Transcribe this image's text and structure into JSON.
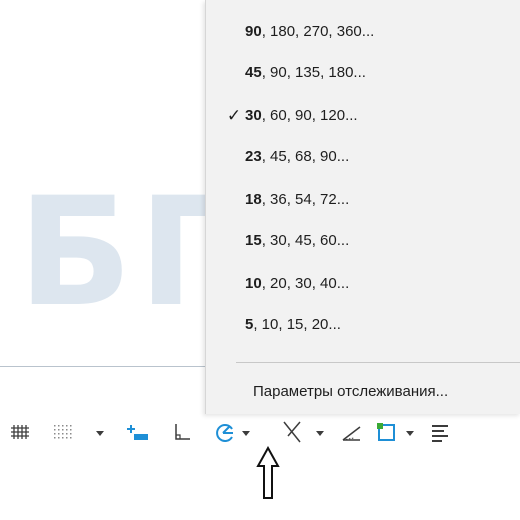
{
  "watermark": {
    "text": "БГАРФ"
  },
  "angle_menu": {
    "selected_index": 2,
    "check_glyph": "✓",
    "items": [
      {
        "bold": "90",
        "rest": ", 180, 270, 360..."
      },
      {
        "bold": "45",
        "rest": ", 90, 135, 180..."
      },
      {
        "bold": "30",
        "rest": ", 60, 90, 120..."
      },
      {
        "bold": "23",
        "rest": ", 45, 68, 90..."
      },
      {
        "bold": "18",
        "rest": ", 36, 54, 72..."
      },
      {
        "bold": "15",
        "rest": ", 30, 45, 60..."
      },
      {
        "bold": "10",
        "rest": ", 20, 30, 40..."
      },
      {
        "bold": "5",
        "rest": ", 10, 15, 20..."
      }
    ],
    "tracking_settings_label": "Параметры отслеживания..."
  },
  "toolbar": {
    "icons": [
      "grid-display-icon",
      "snap-grid-icon",
      "dropdown-arrow-icon",
      "dynamic-input-icon",
      "ortho-mode-icon",
      "polar-tracking-icon",
      "dropdown-arrow-icon",
      "isometric-drafting-icon",
      "dropdown-arrow-icon",
      "object-snap-tracking-icon",
      "object-snap-icon",
      "dropdown-arrow-icon",
      "lineweight-icon"
    ],
    "accent_color": "#1e8fd6",
    "snap_green": "#3aa935"
  }
}
